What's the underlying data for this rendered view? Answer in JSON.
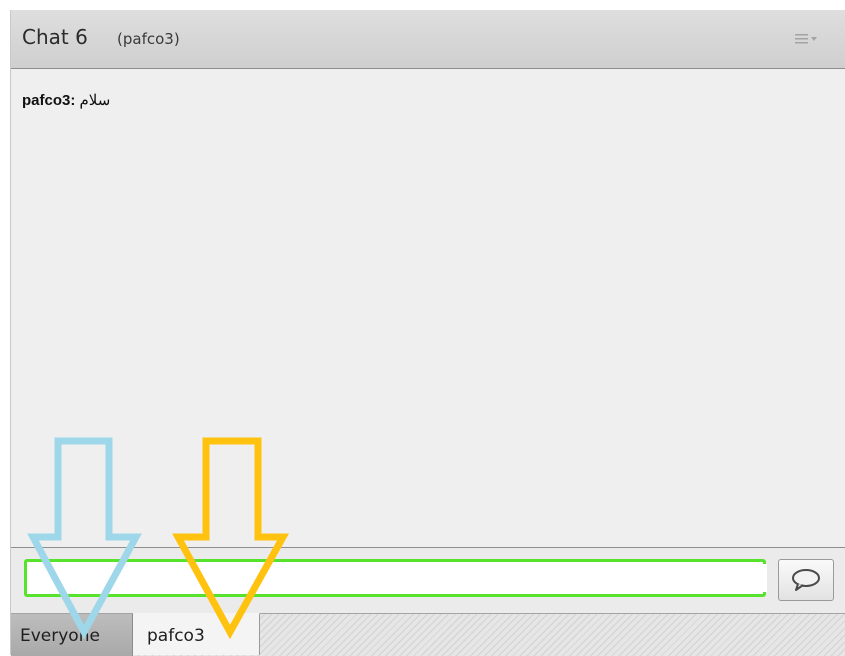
{
  "header": {
    "title": "Chat 6",
    "subtitle": "(pafco3)",
    "menu_icon": "pod-options-menu-icon"
  },
  "messages": [
    {
      "sender": "pafco3:",
      "text": "سلام"
    }
  ],
  "compose": {
    "value": "",
    "send_icon": "speech-bubble-icon"
  },
  "tabs": [
    {
      "label": "Everyone",
      "selected": false
    },
    {
      "label": "pafco3",
      "selected": true
    }
  ],
  "annotations": [
    {
      "name": "blue-arrow",
      "color": "#9fd7ea",
      "direction": "down"
    },
    {
      "name": "orange-arrow",
      "color": "#ffc20e",
      "direction": "down"
    }
  ],
  "colors": {
    "input_focus_border": "#57e22c",
    "header_bg": "#d6d6d6",
    "pod_bg": "#efefef"
  }
}
